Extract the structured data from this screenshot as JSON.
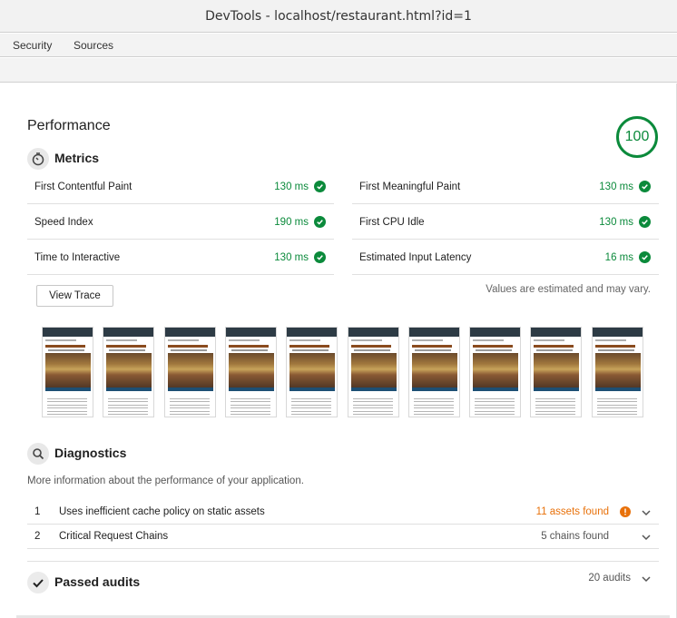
{
  "window": {
    "title": "DevTools - localhost/restaurant.html?id=1"
  },
  "tabs": [
    {
      "label": "Security"
    },
    {
      "label": "Sources"
    }
  ],
  "report": {
    "title": "Performance",
    "score": "100",
    "score_color": "#0b8a3b",
    "metrics_section": {
      "title": "Metrics",
      "icon": "timer-icon",
      "items": [
        {
          "label": "First Contentful Paint",
          "value": "130 ms"
        },
        {
          "label": "First Meaningful Paint",
          "value": "130 ms"
        },
        {
          "label": "Speed Index",
          "value": "190 ms"
        },
        {
          "label": "First CPU Idle",
          "value": "130 ms"
        },
        {
          "label": "Time to Interactive",
          "value": "130 ms"
        },
        {
          "label": "Estimated Input Latency",
          "value": "16 ms"
        }
      ],
      "view_trace_label": "View Trace",
      "note": "Values are estimated and may vary."
    },
    "filmstrip": {
      "frame_count": 10,
      "frame_header": "RESTAURANT REVIEWS",
      "frame_title": "MISSION CHINESE FOOD"
    },
    "diagnostics": {
      "title": "Diagnostics",
      "icon": "search-icon",
      "description": "More information about the performance of your application.",
      "items": [
        {
          "num": "1",
          "title": "Uses inefficient cache policy on static assets",
          "value": "11 assets found",
          "value_color": "#e8710a",
          "info_icon": "info-icon"
        },
        {
          "num": "2",
          "title": "Critical Request Chains",
          "value": "5 chains found",
          "value_color": "#555555"
        }
      ]
    },
    "passed": {
      "title": "Passed audits",
      "icon": "check-icon",
      "value": "20 audits"
    }
  }
}
